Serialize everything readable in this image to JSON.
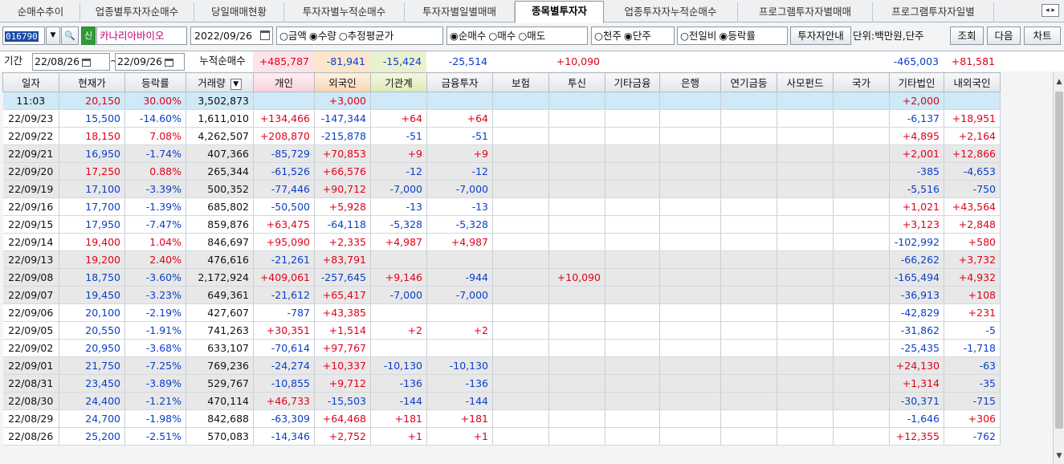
{
  "tabs": [
    "순매수추이",
    "업종별투자자순매수",
    "당일매매현황",
    "투자자별누적순매수",
    "투자자별일별매매",
    "종목별투자자",
    "업종투자자누적순매수",
    "프로그램투자자별매매",
    "프로그램투자자일별"
  ],
  "tab_arrows": "◂ ▸",
  "toolbar": {
    "code": "016790",
    "search_icon": "🔍",
    "shin": "신",
    "stock_name": "카나리아바이오",
    "date": "2022/09/26",
    "opt_amount": "○금액",
    "opt_qty": "◉수량",
    "opt_avg": "○추정평균가",
    "opt_net": "◉순매수",
    "opt_buy": "○매수",
    "opt_sell": "○매도",
    "opt_thousand": "○천주",
    "opt_unit": "◉단주",
    "opt_prev": "○전일비",
    "opt_rate": "◉등락률",
    "btn_guide": "투자자안내",
    "unit_label": "단위:백만원,단주",
    "btn_search": "조회",
    "btn_next": "다음",
    "btn_chart": "차트"
  },
  "period": {
    "label": "기간",
    "from": "22/08/26",
    "tilde": "~",
    "to": "22/09/26",
    "cum_label": "누적순매수",
    "sums": [
      {
        "col": "ind",
        "v": "+485,787"
      },
      {
        "col": "for",
        "v": "-81,941"
      },
      {
        "col": "inst",
        "v": "-15,424"
      },
      {
        "col": "fin",
        "v": "-25,514"
      },
      {
        "col": "trust",
        "v": "+10,090"
      },
      {
        "col": "corp",
        "v": "-465,003"
      },
      {
        "col": "dom",
        "v": "+81,581"
      }
    ]
  },
  "headers": [
    "일자",
    "현재가",
    "등락률",
    "거래량",
    "개인",
    "외국인",
    "기관계",
    "금융투자",
    "보험",
    "투신",
    "기타금융",
    "은행",
    "연기금등",
    "사모펀드",
    "국가",
    "기타법인",
    "내외국인"
  ],
  "rows": [
    [
      "11:03",
      "20,150",
      "30.00%",
      "3,502,873",
      "",
      "+3,000",
      "",
      "",
      "",
      "",
      "",
      "",
      "",
      "",
      "",
      "+2,000",
      ""
    ],
    [
      "22/09/23",
      "15,500",
      "-14.60%",
      "1,611,010",
      "+134,466",
      "-147,344",
      "+64",
      "+64",
      "",
      "",
      "",
      "",
      "",
      "",
      "",
      "-6,137",
      "+18,951"
    ],
    [
      "22/09/22",
      "18,150",
      "7.08%",
      "4,262,507",
      "+208,870",
      "-215,878",
      "-51",
      "-51",
      "",
      "",
      "",
      "",
      "",
      "",
      "",
      "+4,895",
      "+2,164"
    ],
    [
      "22/09/21",
      "16,950",
      "-1.74%",
      "407,366",
      "-85,729",
      "+70,853",
      "+9",
      "+9",
      "",
      "",
      "",
      "",
      "",
      "",
      "",
      "+2,001",
      "+12,866"
    ],
    [
      "22/09/20",
      "17,250",
      "0.88%",
      "265,344",
      "-61,526",
      "+66,576",
      "-12",
      "-12",
      "",
      "",
      "",
      "",
      "",
      "",
      "",
      "-385",
      "-4,653"
    ],
    [
      "22/09/19",
      "17,100",
      "-3.39%",
      "500,352",
      "-77,446",
      "+90,712",
      "-7,000",
      "-7,000",
      "",
      "",
      "",
      "",
      "",
      "",
      "",
      "-5,516",
      "-750"
    ],
    [
      "22/09/16",
      "17,700",
      "-1.39%",
      "685,802",
      "-50,500",
      "+5,928",
      "-13",
      "-13",
      "",
      "",
      "",
      "",
      "",
      "",
      "",
      "+1,021",
      "+43,564"
    ],
    [
      "22/09/15",
      "17,950",
      "-7.47%",
      "859,876",
      "+63,475",
      "-64,118",
      "-5,328",
      "-5,328",
      "",
      "",
      "",
      "",
      "",
      "",
      "",
      "+3,123",
      "+2,848"
    ],
    [
      "22/09/14",
      "19,400",
      "1.04%",
      "846,697",
      "+95,090",
      "+2,335",
      "+4,987",
      "+4,987",
      "",
      "",
      "",
      "",
      "",
      "",
      "",
      "-102,992",
      "+580"
    ],
    [
      "22/09/13",
      "19,200",
      "2.40%",
      "476,616",
      "-21,261",
      "+83,791",
      "",
      "",
      "",
      "",
      "",
      "",
      "",
      "",
      "",
      "-66,262",
      "+3,732"
    ],
    [
      "22/09/08",
      "18,750",
      "-3.60%",
      "2,172,924",
      "+409,061",
      "-257,645",
      "+9,146",
      "-944",
      "",
      "+10,090",
      "",
      "",
      "",
      "",
      "",
      "-165,494",
      "+4,932"
    ],
    [
      "22/09/07",
      "19,450",
      "-3.23%",
      "649,361",
      "-21,612",
      "+65,417",
      "-7,000",
      "-7,000",
      "",
      "",
      "",
      "",
      "",
      "",
      "",
      "-36,913",
      "+108"
    ],
    [
      "22/09/06",
      "20,100",
      "-2.19%",
      "427,607",
      "-787",
      "+43,385",
      "",
      "",
      "",
      "",
      "",
      "",
      "",
      "",
      "",
      "-42,829",
      "+231"
    ],
    [
      "22/09/05",
      "20,550",
      "-1.91%",
      "741,263",
      "+30,351",
      "+1,514",
      "+2",
      "+2",
      "",
      "",
      "",
      "",
      "",
      "",
      "",
      "-31,862",
      "-5"
    ],
    [
      "22/09/02",
      "20,950",
      "-3.68%",
      "633,107",
      "-70,614",
      "+97,767",
      "",
      "",
      "",
      "",
      "",
      "",
      "",
      "",
      "",
      "-25,435",
      "-1,718"
    ],
    [
      "22/09/01",
      "21,750",
      "-7.25%",
      "769,236",
      "-24,274",
      "+10,337",
      "-10,130",
      "-10,130",
      "",
      "",
      "",
      "",
      "",
      "",
      "",
      "+24,130",
      "-63"
    ],
    [
      "22/08/31",
      "23,450",
      "-3.89%",
      "529,767",
      "-10,855",
      "+9,712",
      "-136",
      "-136",
      "",
      "",
      "",
      "",
      "",
      "",
      "",
      "+1,314",
      "-35"
    ],
    [
      "22/08/30",
      "24,400",
      "-1.21%",
      "470,114",
      "+46,733",
      "-15,503",
      "-144",
      "-144",
      "",
      "",
      "",
      "",
      "",
      "",
      "",
      "-30,371",
      "-715"
    ],
    [
      "22/08/29",
      "24,700",
      "-1.98%",
      "842,688",
      "-63,309",
      "+64,468",
      "+181",
      "+181",
      "",
      "",
      "",
      "",
      "",
      "",
      "",
      "-1,646",
      "+306"
    ],
    [
      "22/08/26",
      "25,200",
      "-2.51%",
      "570,083",
      "-14,346",
      "+2,752",
      "+1",
      "+1",
      "",
      "",
      "",
      "",
      "",
      "",
      "",
      "+12,355",
      "-762"
    ]
  ],
  "colors": {
    "up": "#e0001a",
    "down": "#0a3ec9",
    "accent": "#1a4aa6"
  }
}
